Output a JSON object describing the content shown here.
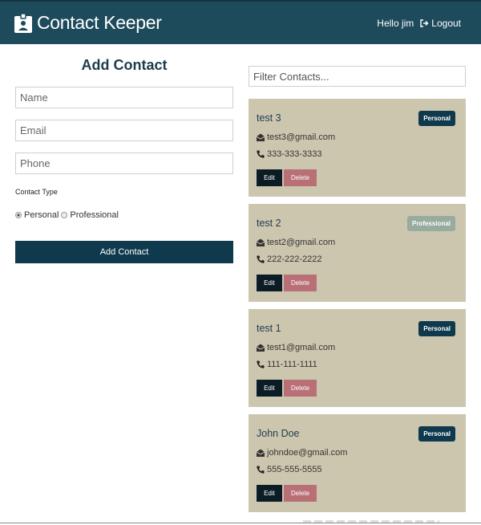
{
  "navbar": {
    "title": "Contact Keeper",
    "greeting": "Hello jim",
    "logout_label": "Logout"
  },
  "form": {
    "title": "Add Contact",
    "name_placeholder": "Name",
    "email_placeholder": "Email",
    "phone_placeholder": "Phone",
    "type_label": "Contact Type",
    "option_personal": "Personal",
    "option_professional": "Professional",
    "selected_type": "Personal",
    "submit_label": "Add Contact"
  },
  "filter": {
    "placeholder": "Filter Contacts..."
  },
  "contacts": [
    {
      "name": "test 3",
      "email": "test3@gmail.com",
      "phone": "333-333-3333",
      "type": "Personal",
      "edit_label": "Edit",
      "delete_label": "Delete"
    },
    {
      "name": "test 2",
      "email": "test2@gmail.com",
      "phone": "222-222-2222",
      "type": "Professional",
      "edit_label": "Edit",
      "delete_label": "Delete"
    },
    {
      "name": "test 1",
      "email": "test1@gmail.com",
      "phone": "111-111-1111",
      "type": "Personal",
      "edit_label": "Edit",
      "delete_label": "Delete"
    },
    {
      "name": "John Doe",
      "email": "johndoe@gmail.com",
      "phone": "555-555-5555",
      "type": "Personal",
      "edit_label": "Edit",
      "delete_label": "Delete"
    }
  ],
  "colors": {
    "navbar": "#1e4b5b",
    "primary": "#0f3a4d",
    "card": "#cdc6af",
    "delete": "#b96f76",
    "professional_badge": "#97ab9f",
    "edit": "#0b1c25"
  },
  "icons": {
    "brand": "id-badge-icon",
    "logout": "sign-out-icon",
    "email": "envelope-open-icon",
    "phone": "phone-icon"
  }
}
